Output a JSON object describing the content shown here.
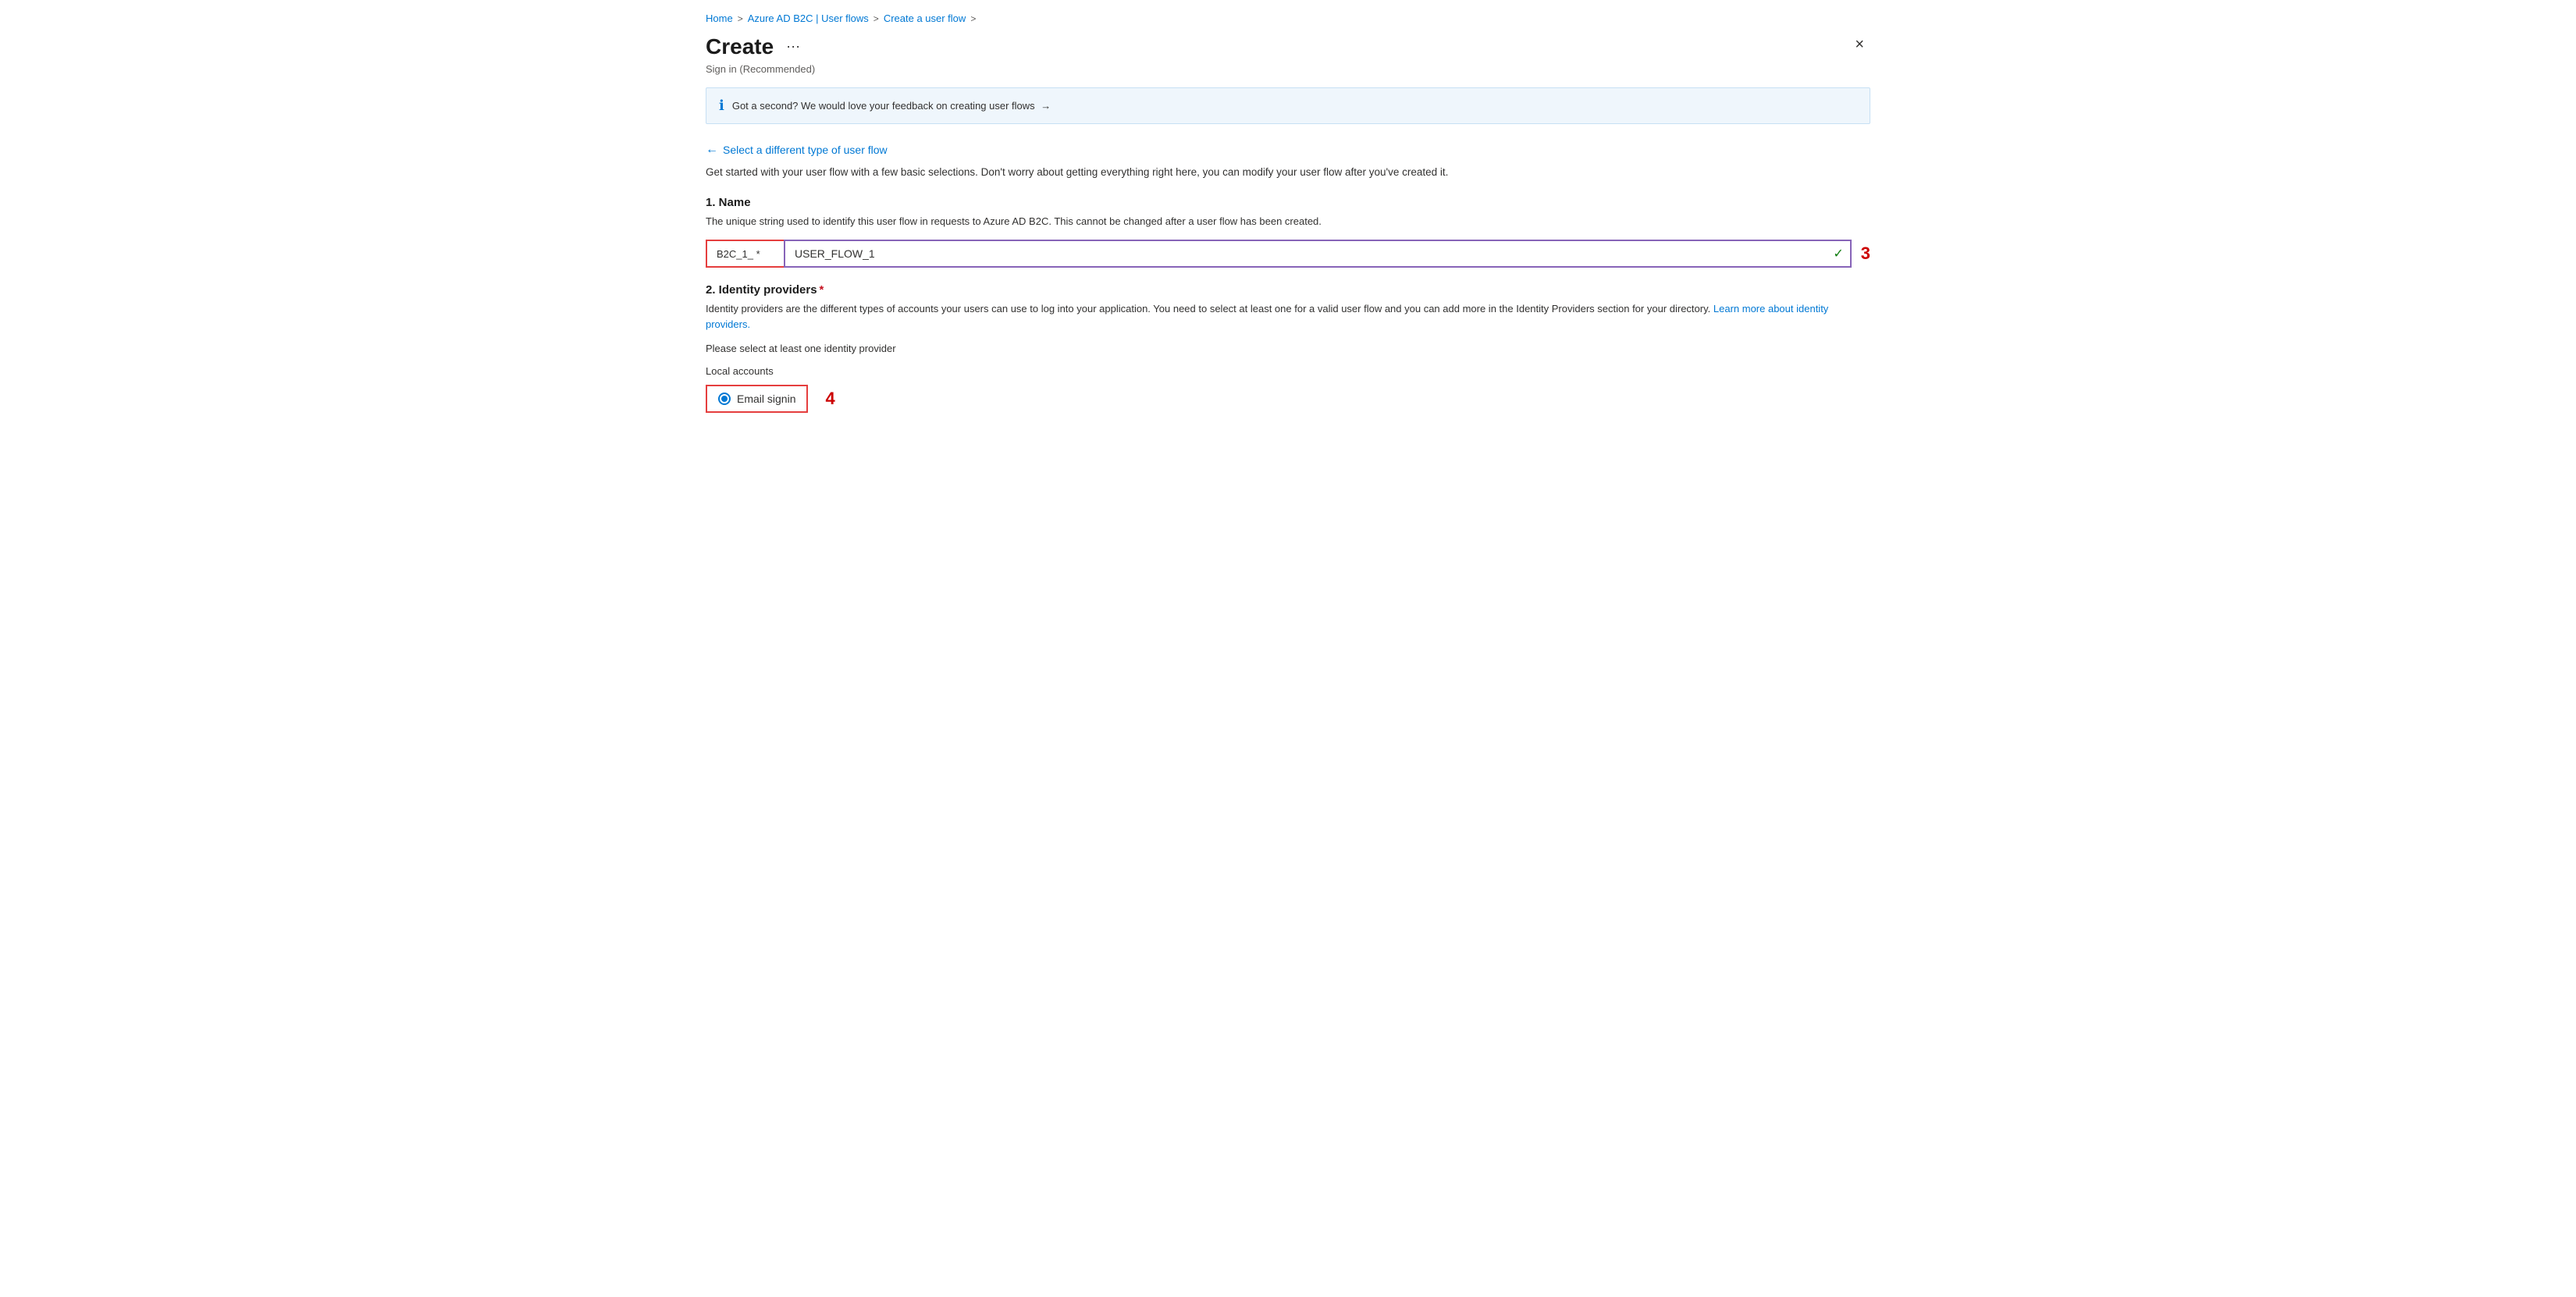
{
  "breadcrumb": {
    "home": "Home",
    "sep1": ">",
    "azureAD": "Azure AD B2C | User flows",
    "sep2": ">",
    "create": "Create a user flow",
    "sep3": ">"
  },
  "header": {
    "title": "Create",
    "ellipsis": "···",
    "subtitle": "Sign in (Recommended)",
    "close_label": "×"
  },
  "banner": {
    "text": "Got a second? We would love your feedback on creating user flows",
    "arrow": "→"
  },
  "back_link": {
    "arrow": "←",
    "label": "Select a different type of user flow"
  },
  "intro": {
    "text": "Get started with your user flow with a few basic selections. Don't worry about getting everything right here, you can modify your user flow after you've created it."
  },
  "name_section": {
    "title": "1. Name",
    "desc": "The unique string used to identify this user flow in requests to Azure AD B2C. This cannot be changed after a user flow has been created.",
    "prefix": "B2C_1_ *",
    "input_value": "USER_FLOW_1",
    "annotation": "3",
    "checkmark": "✓"
  },
  "identity_section": {
    "title": "2. Identity providers",
    "required_star": "*",
    "desc_part1": "Identity providers are the different types of accounts your users can use to log into your application. You need to select at least one for a valid user flow and you can add more in the Identity Providers section for your directory.",
    "desc_link": "Learn more about identity providers.",
    "please_select": "Please select at least one identity provider",
    "local_accounts_label": "Local accounts",
    "email_signin_label": "Email signin",
    "annotation": "4"
  }
}
